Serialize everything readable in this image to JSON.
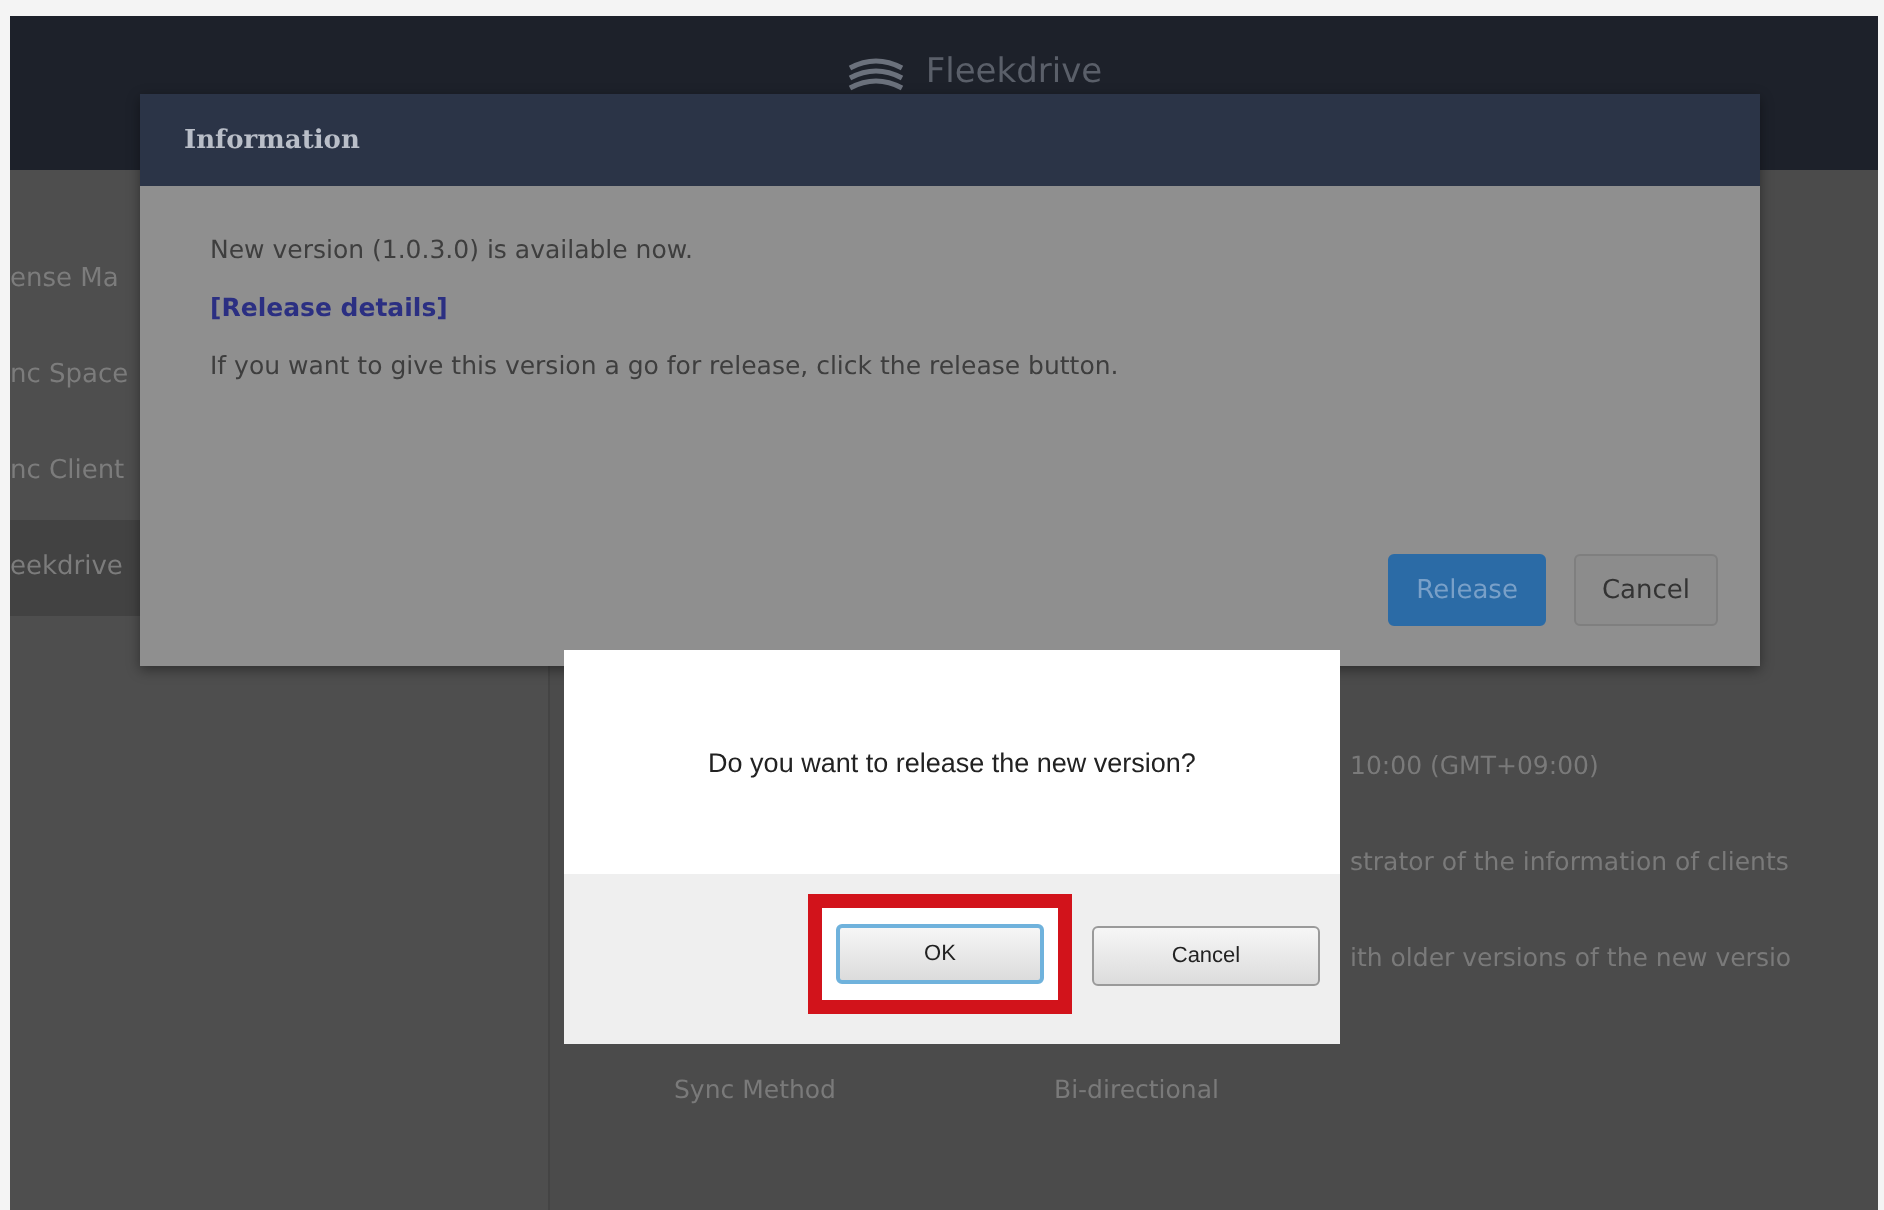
{
  "app": {
    "title": "Fleekdrive"
  },
  "sidebar": {
    "items": [
      {
        "label": "ense Ma",
        "selected": false
      },
      {
        "label": "nc Space",
        "selected": false
      },
      {
        "label": "nc Client",
        "selected": false
      },
      {
        "label": "eekdrive",
        "selected": true
      }
    ]
  },
  "content": {
    "rows": [
      {
        "kind": "text",
        "text": "10:00 (GMT+09:00)"
      },
      {
        "kind": "text",
        "text": "strator of the information of clients"
      },
      {
        "kind": "text",
        "text": "ith older versions of the new versio"
      },
      {
        "kind": "pair",
        "label": "Sync Method",
        "value": "Bi-directional"
      }
    ]
  },
  "info_dialog": {
    "title": "Information",
    "message": "New version (1.0.3.0) is available now.",
    "link": "[Release details]",
    "instruction": "If you want to give this version a go for release, click the release button.",
    "buttons": [
      {
        "label": "Release",
        "kind": "primary"
      },
      {
        "label": "Cancel",
        "kind": "secondary"
      }
    ]
  },
  "confirm_dialog": {
    "message": "Do you want to release the new version?",
    "buttons": [
      {
        "label": "OK",
        "highlighted": true
      },
      {
        "label": "Cancel",
        "highlighted": false
      }
    ]
  }
}
